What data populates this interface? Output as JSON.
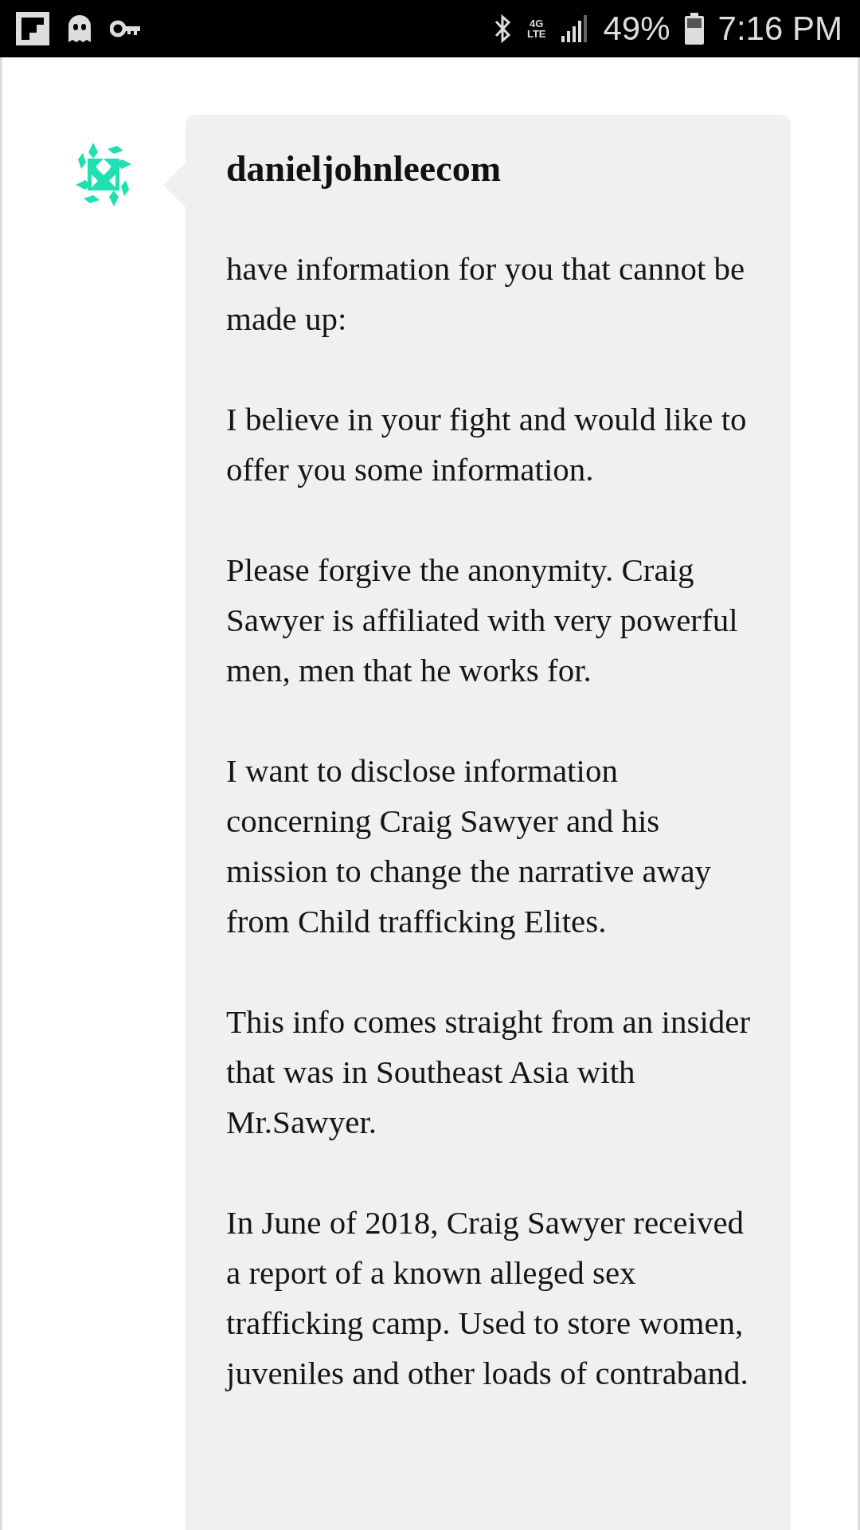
{
  "status_bar": {
    "network": "4G",
    "network_sub": "LTE",
    "battery": "49%",
    "time": "7:16 PM"
  },
  "comment": {
    "author": "danieljohnleecom",
    "paragraphs": [
      "have information for you that cannot be made up:",
      "I believe in your fight and would like to offer you some information.",
      "Please forgive the anonymity. Craig Sawyer is affiliated with very powerful men, men that he works for.",
      "I want to disclose information concerning Craig Sawyer and his mission to change the narrative away from Child trafficking Elites.",
      "This info comes straight from an insider that was in Southeast Asia with Mr.Sawyer.",
      "In June of 2018, Craig Sawyer received a report of a known alleged sex trafficking camp. Used to store women, juveniles and other loads of contraband."
    ]
  }
}
